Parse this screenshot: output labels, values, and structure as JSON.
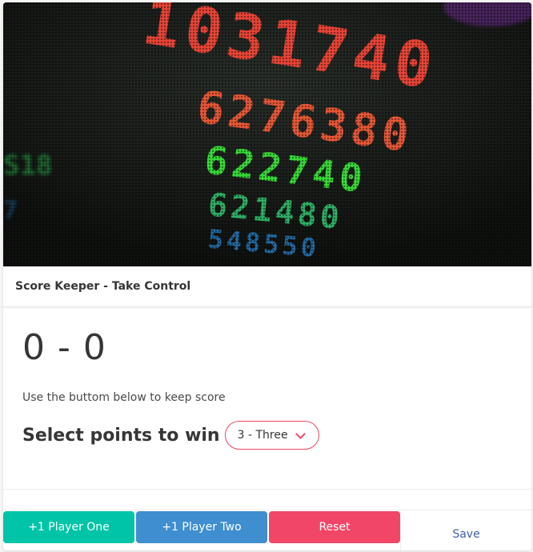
{
  "card": {
    "title": "Score Keeper - Take Control",
    "image": {
      "digit_rows": [
        {
          "text": "1031740",
          "color": "#ff4a3a"
        },
        {
          "text": "6276380",
          "color": "#ff5a3a"
        },
        {
          "text": "622740",
          "color": "#3cf03c"
        },
        {
          "text": "621480",
          "color": "#35d87a"
        },
        {
          "text": "548550",
          "color": "#2a8fe0"
        }
      ]
    }
  },
  "score": {
    "player_one": "0",
    "separator": "-",
    "player_two": "0",
    "display": "0 - 0"
  },
  "hint_text": "Use the buttom below to keep score",
  "win_select": {
    "label": "Select points to win",
    "selected": "3 - Three"
  },
  "footer": {
    "player_one_button": "+1 Player One",
    "player_two_button": "+1 Player Two",
    "reset_button": "Reset",
    "save_link": "Save"
  },
  "colors": {
    "player_one": "#00c4a7",
    "player_two": "#3e8ed0",
    "reset": "#f14668",
    "save": "#3e5fa8"
  }
}
